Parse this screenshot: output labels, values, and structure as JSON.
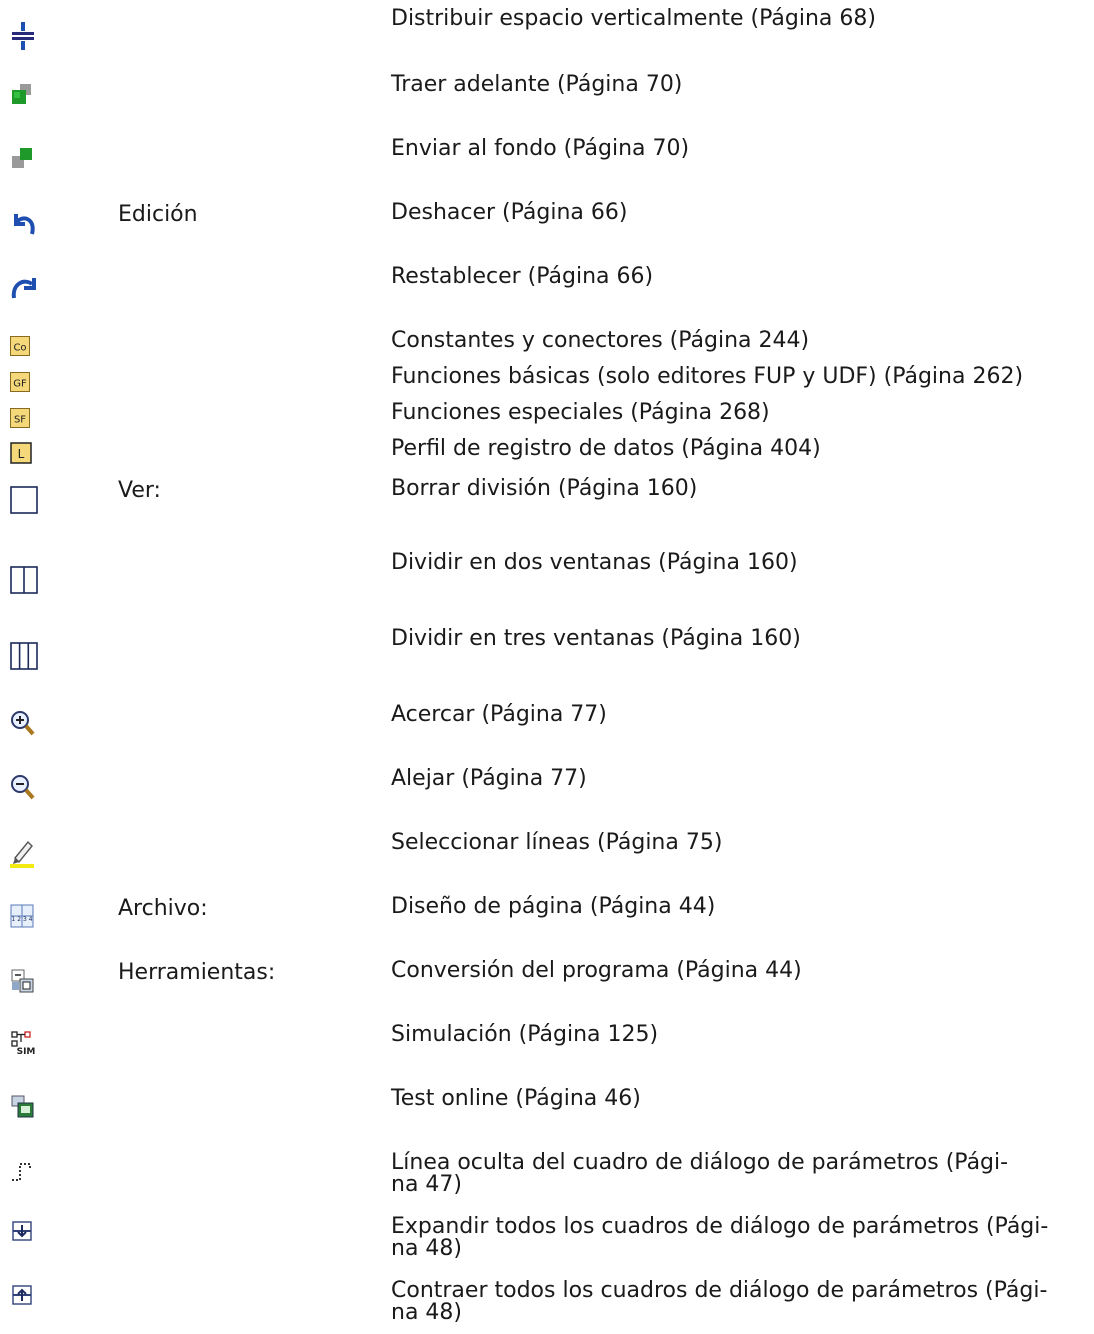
{
  "rows": [
    {
      "icon": "distribute-vertical-icon",
      "menu": "",
      "text": "Distribuir espacio verticalmente (Página 68)"
    },
    {
      "icon": "bring-forward-icon",
      "menu": "",
      "text": "Traer adelante (Página 70)"
    },
    {
      "icon": "send-to-back-icon",
      "menu": "",
      "text": "Enviar al fondo (Página 70)"
    },
    {
      "icon": "undo-icon",
      "menu": "Edición",
      "text": "Deshacer (Página 66)"
    },
    {
      "icon": "redo-icon",
      "menu": "",
      "text": "Restablecer (Página 66)"
    },
    {
      "icon": "co-block-icon",
      "icon_text": "Co",
      "menu": "",
      "text": "Constantes y conectores (Página 244)"
    },
    {
      "icon": "gf-block-icon",
      "icon_text": "GF",
      "menu": "",
      "text": "Funciones básicas (solo editores FUP y UDF) (Página 262)"
    },
    {
      "icon": "sf-block-icon",
      "icon_text": "SF",
      "menu": "",
      "text": "Funciones especiales (Página 268)"
    },
    {
      "icon": "l-block-icon",
      "icon_text": "L",
      "menu": "",
      "text": "Perfil de registro de datos (Página 404)"
    },
    {
      "icon": "single-window-icon",
      "menu": "Ver:",
      "text": "Borrar división (Página 160)"
    },
    {
      "icon": "split-two-icon",
      "menu": "",
      "text": "Dividir en dos ventanas (Página 160)"
    },
    {
      "icon": "split-three-icon",
      "menu": "",
      "text": "Dividir en tres ventanas (Página 160)"
    },
    {
      "icon": "zoom-in-icon",
      "menu": "",
      "text": "Acercar (Página 77)"
    },
    {
      "icon": "zoom-out-icon",
      "menu": "",
      "text": "Alejar (Página 77)"
    },
    {
      "icon": "select-lines-icon",
      "menu": "",
      "text": "Seleccionar líneas (Página 75)"
    },
    {
      "icon": "page-layout-icon",
      "icon_text": "1 2 3 4",
      "menu": "Archivo:",
      "text": "Diseño de página (Página 44)"
    },
    {
      "icon": "program-conversion-icon",
      "menu": "Herramientas:",
      "text": "Conversión del programa (Página 44)"
    },
    {
      "icon": "simulation-icon",
      "icon_text": "SIM",
      "menu": "",
      "text": "Simulación (Página 125)"
    },
    {
      "icon": "online-test-icon",
      "menu": "",
      "text": "Test online (Página 46)"
    },
    {
      "icon": "hidden-line-icon",
      "menu": "",
      "text": "Línea oculta del cuadro de diálogo de parámetros (Pági-\nna 47)"
    },
    {
      "icon": "expand-all-icon",
      "menu": "",
      "text": "Expandir todos los cuadros de diálogo de parámetros (Pági-\nna 48)"
    },
    {
      "icon": "collapse-all-icon",
      "menu": "",
      "text": "Contraer todos los cuadros de diálogo de parámetros (Pági-\nna 48)"
    }
  ]
}
